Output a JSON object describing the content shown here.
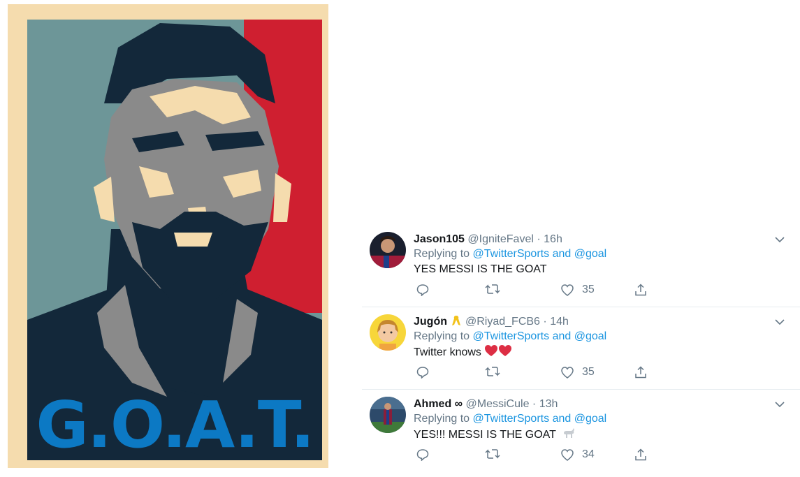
{
  "poster": {
    "headline": "G.O.A.T.",
    "colors": {
      "frame": "#f5dcae",
      "left_panel": "#6d9698",
      "right_panel": "#cf1f30",
      "shadow": "#13283a",
      "gray": "#8a8a8a",
      "highlight": "#f5dcae",
      "headline": "#0c79c4"
    }
  },
  "tweets": [
    {
      "username": "Jason105",
      "handle": "@IgniteFavel",
      "separator": "·",
      "time": "16h",
      "reply_prefix": "Replying to",
      "reply_mention_1": "@TwitterSports",
      "reply_and": "and",
      "reply_mention_2": "@goal",
      "text": "YES MESSI IS THE GOAT",
      "likes": "35",
      "avatar_icon": "avatar-player-photo"
    },
    {
      "username": "Jugón",
      "handle": "@Riyad_FCB6",
      "separator": "·",
      "time": "14h",
      "reply_prefix": "Replying to",
      "reply_mention_1": "@TwitterSports",
      "reply_and": "and",
      "reply_mention_2": "@goal",
      "text": "Twitter knows",
      "likes": "35",
      "avatar_icon": "avatar-cartoon-boy",
      "emoji": "red-hearts"
    },
    {
      "username": "Ahmed ∞",
      "handle": "@MessiCule",
      "separator": "·",
      "time": "13h",
      "reply_prefix": "Replying to",
      "reply_mention_1": "@TwitterSports",
      "reply_and": "and",
      "reply_mention_2": "@goal",
      "text": "YES!!! MESSI IS THE GOAT",
      "likes": "34",
      "avatar_icon": "avatar-stadium-photo",
      "emoji": "goat"
    }
  ],
  "link_color": "#1b95e0",
  "muted_color": "#657786"
}
